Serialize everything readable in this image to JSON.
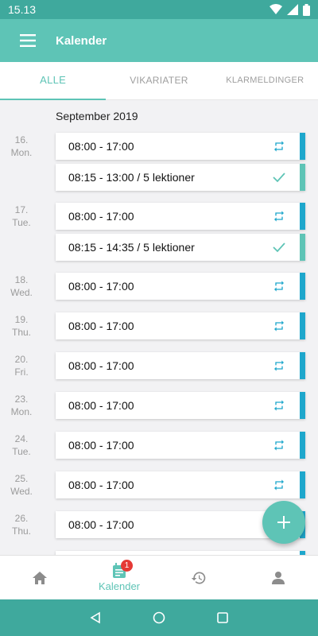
{
  "status_bar": {
    "time": "15.13"
  },
  "app_bar": {
    "title": "Kalender"
  },
  "tabs": [
    {
      "label": "ALLE",
      "active": true
    },
    {
      "label": "VIKARIATER",
      "active": false
    },
    {
      "label": "KLARMELDINGER",
      "active": false
    }
  ],
  "month": "September 2019",
  "days": [
    {
      "date": "16.",
      "weekday": "Mon."
    },
    {
      "date": "17.",
      "weekday": "Tue."
    },
    {
      "date": "18.",
      "weekday": "Wed."
    },
    {
      "date": "19.",
      "weekday": "Thu."
    },
    {
      "date": "20.",
      "weekday": "Fri."
    },
    {
      "date": "23.",
      "weekday": "Mon."
    },
    {
      "date": "24.",
      "weekday": "Tue."
    },
    {
      "date": "25.",
      "weekday": "Wed."
    },
    {
      "date": "26.",
      "weekday": "Thu."
    }
  ],
  "entries": [
    {
      "text": "08:00 - 17:00",
      "icon": "repeat-icon",
      "status": "scheduled"
    },
    {
      "text": "08:15 - 13:00  /  5 lektioner",
      "icon": "checkmark-icon",
      "status": "done"
    },
    {
      "text": "08:00 - 17:00",
      "icon": "repeat-icon",
      "status": "scheduled"
    },
    {
      "text": "08:15 - 14:35  /  5 lektioner",
      "icon": "checkmark-icon",
      "status": "done"
    },
    {
      "text": "08:00 - 17:00",
      "icon": "repeat-icon",
      "status": "scheduled"
    },
    {
      "text": "08:00 - 17:00",
      "icon": "repeat-icon",
      "status": "scheduled"
    },
    {
      "text": "08:00 - 17:00",
      "icon": "repeat-icon",
      "status": "scheduled"
    },
    {
      "text": "08:00 - 17:00",
      "icon": "repeat-icon",
      "status": "scheduled"
    },
    {
      "text": "08:00 - 17:00",
      "icon": "repeat-icon",
      "status": "scheduled"
    },
    {
      "text": "08:00 - 17:00",
      "icon": "repeat-icon",
      "status": "scheduled"
    },
    {
      "text": "08:00 - 17:00",
      "icon": "repeat-icon",
      "status": "scheduled"
    }
  ],
  "bottom_nav": {
    "items": [
      {
        "icon": "home-icon",
        "label": ""
      },
      {
        "icon": "calendar-icon",
        "label": "Kalender",
        "badge": "1",
        "active": true
      },
      {
        "icon": "history-icon",
        "label": ""
      },
      {
        "icon": "person-icon",
        "label": ""
      }
    ]
  },
  "colors": {
    "primary": "#5ec4b6",
    "status_bar": "#3fa99d",
    "scheduled_bar": "#1ea7cc",
    "done_bar": "#5ec4b6",
    "badge": "#e53935"
  }
}
